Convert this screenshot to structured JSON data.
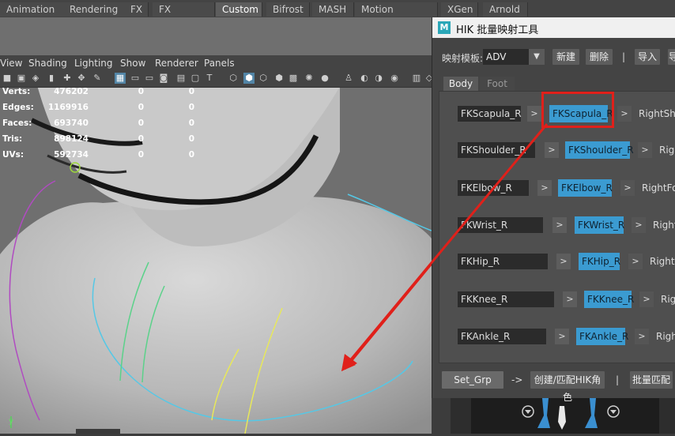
{
  "shelf_tabs": [
    "Animation",
    "Rendering",
    "FX",
    "FX Caching",
    "Custom",
    "Bifrost",
    "MASH",
    "Motion Graphics",
    "XGen",
    "Arnold"
  ],
  "shelf_active": "Custom",
  "viewport_menu": [
    "View",
    "Shading",
    "Lighting",
    "Show",
    "Renderer",
    "Panels"
  ],
  "hud": [
    {
      "label": "Verts:",
      "v1": "476202",
      "v2": "0",
      "v3": "0"
    },
    {
      "label": "Edges:",
      "v1": "1169916",
      "v2": "0",
      "v3": "0"
    },
    {
      "label": "Faces:",
      "v1": "693740",
      "v2": "0",
      "v3": "0"
    },
    {
      "label": "Tris:",
      "v1": "898124",
      "v2": "0",
      "v3": "0"
    },
    {
      "label": "UVs:",
      "v1": "592734",
      "v2": "0",
      "v3": "0"
    }
  ],
  "axis_label": "y",
  "dialog": {
    "logo": "M",
    "title": "HIK 批量映射工具",
    "template_label": "映射模板:",
    "template_value": "ADV",
    "new_button": "新建",
    "delete_button": "删除",
    "sep": "|",
    "import_button": "导入",
    "export_button": "导",
    "tabs": [
      "Body",
      "Foot"
    ],
    "active_tab": "Body",
    "rows": [
      {
        "source": "FKScapula_R",
        "target": "FKScapula_R",
        "hik": "RightShoulder"
      },
      {
        "source": "FKShoulder_R",
        "target": "FKShoulder_R",
        "hik": "RightArm"
      },
      {
        "source": "FKElbow_R",
        "target": "FKElbow_R",
        "hik": "RightForeArm"
      },
      {
        "source": "FKWrist_R",
        "target": "FKWrist_R",
        "hik": "RightHand"
      },
      {
        "source": "FKHip_R",
        "target": "FKHip_R",
        "hik": "RightUpLeg"
      },
      {
        "source": "FKKnee_R",
        "target": "FKKnee_R",
        "hik": "RightLeg"
      },
      {
        "source": "FKAnkle_R",
        "target": "FKAnkle_R",
        "hik": "RightFoot"
      }
    ],
    "arrow_glyph": ">",
    "set_grp_button": "Set_Grp",
    "flow_arrow": "->",
    "create_button": "创建/匹配HIK角色",
    "sep2": "|",
    "batch_button": "批量匹配"
  },
  "colors": {
    "accent_blue": "#3b9bd1",
    "highlight_red": "#e0201a"
  }
}
